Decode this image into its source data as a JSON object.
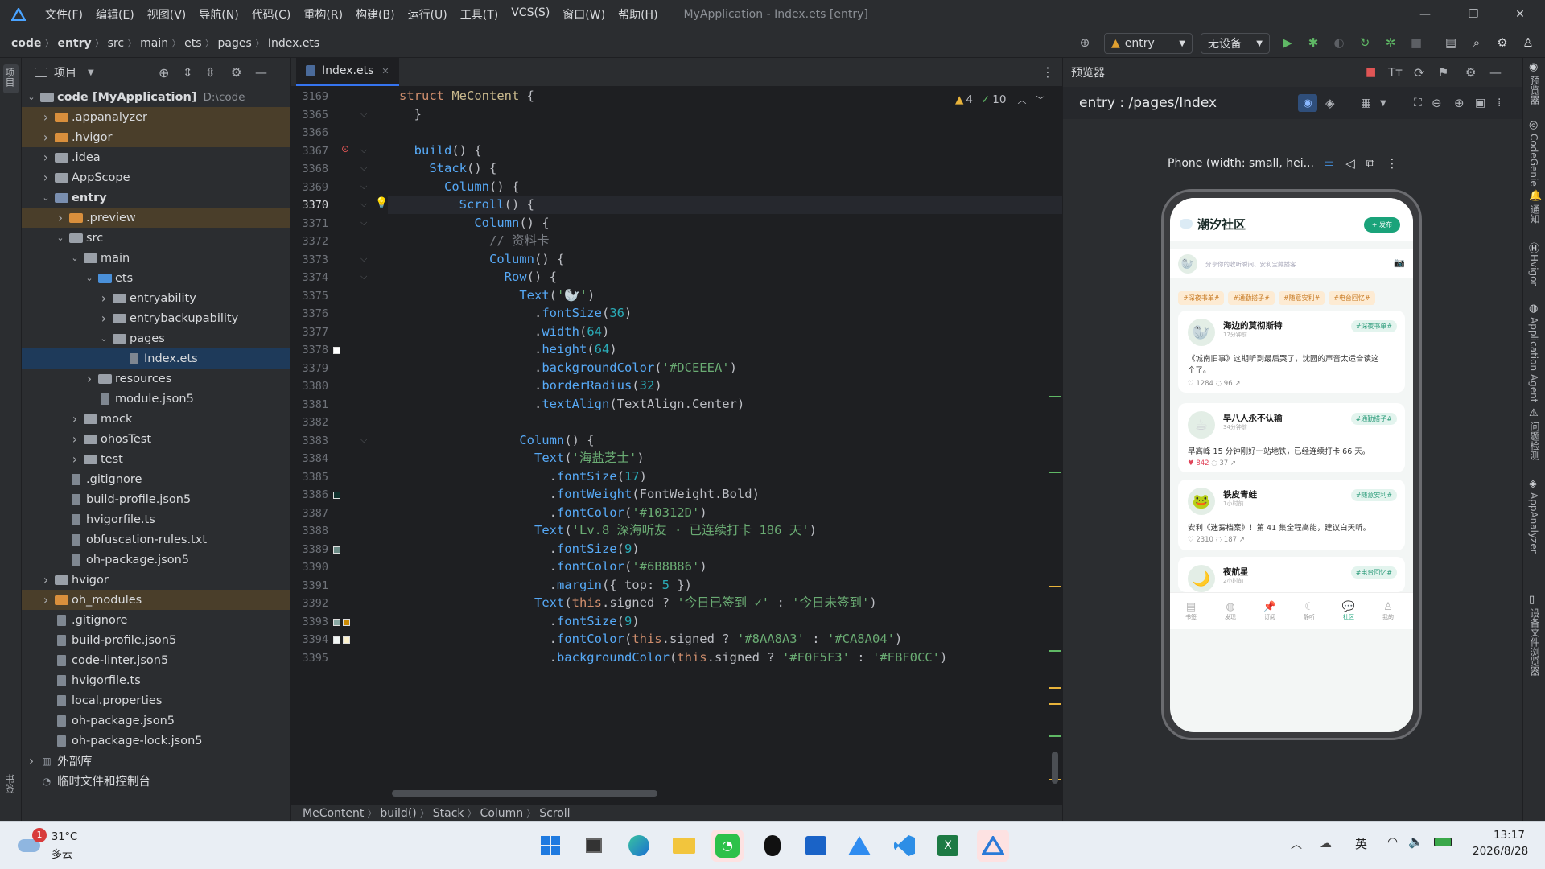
{
  "titlebar": {
    "menus": [
      "文件(F)",
      "编辑(E)",
      "视图(V)",
      "导航(N)",
      "代码(C)",
      "重构(R)",
      "构建(B)",
      "运行(U)",
      "工具(T)",
      "VCS(S)",
      "窗口(W)",
      "帮助(H)"
    ],
    "window_title": "MyApplication - Index.ets [entry]"
  },
  "breadcrumb": [
    "code",
    "entry",
    "src",
    "main",
    "ets",
    "pages",
    "Index.ets"
  ],
  "toolbar": {
    "module": "entry",
    "device": "无设备"
  },
  "project": {
    "title": "项目",
    "tree": [
      {
        "depth": 0,
        "arrow": "v",
        "kind": "folder",
        "label": "code [MyApplication]",
        "suffix": "D:\\code",
        "bold": true
      },
      {
        "depth": 1,
        "arrow": ">",
        "kind": "orange",
        "label": ".appanalyzer",
        "hl": "excl"
      },
      {
        "depth": 1,
        "arrow": ">",
        "kind": "orange",
        "label": ".hvigor",
        "hl": "excl"
      },
      {
        "depth": 1,
        "arrow": ">",
        "kind": "folder",
        "label": ".idea"
      },
      {
        "depth": 1,
        "arrow": ">",
        "kind": "folder",
        "label": "AppScope"
      },
      {
        "depth": 1,
        "arrow": "v",
        "kind": "module",
        "label": "entry",
        "bold": true
      },
      {
        "depth": 2,
        "arrow": ">",
        "kind": "orange",
        "label": ".preview",
        "hl": "excl"
      },
      {
        "depth": 2,
        "arrow": "v",
        "kind": "folder",
        "label": "src"
      },
      {
        "depth": 3,
        "arrow": "v",
        "kind": "folder",
        "label": "main"
      },
      {
        "depth": 4,
        "arrow": "v",
        "kind": "blue",
        "label": "ets"
      },
      {
        "depth": 5,
        "arrow": ">",
        "kind": "folder",
        "label": "entryability"
      },
      {
        "depth": 5,
        "arrow": ">",
        "kind": "folder",
        "label": "entrybackupability"
      },
      {
        "depth": 5,
        "arrow": "v",
        "kind": "folder",
        "label": "pages"
      },
      {
        "depth": 6,
        "arrow": "",
        "kind": "file",
        "label": "Index.ets",
        "hl": "sel"
      },
      {
        "depth": 4,
        "arrow": ">",
        "kind": "folder",
        "label": "resources"
      },
      {
        "depth": 4,
        "arrow": "",
        "kind": "file",
        "label": "module.json5"
      },
      {
        "depth": 3,
        "arrow": ">",
        "kind": "folder",
        "label": "mock"
      },
      {
        "depth": 3,
        "arrow": ">",
        "kind": "folder",
        "label": "ohosTest"
      },
      {
        "depth": 3,
        "arrow": ">",
        "kind": "folder",
        "label": "test"
      },
      {
        "depth": 2,
        "arrow": "",
        "kind": "file",
        "label": ".gitignore"
      },
      {
        "depth": 2,
        "arrow": "",
        "kind": "file",
        "label": "build-profile.json5"
      },
      {
        "depth": 2,
        "arrow": "",
        "kind": "file",
        "label": "hvigorfile.ts"
      },
      {
        "depth": 2,
        "arrow": "",
        "kind": "file",
        "label": "obfuscation-rules.txt"
      },
      {
        "depth": 2,
        "arrow": "",
        "kind": "file",
        "label": "oh-package.json5"
      },
      {
        "depth": 1,
        "arrow": ">",
        "kind": "folder",
        "label": "hvigor"
      },
      {
        "depth": 1,
        "arrow": ">",
        "kind": "orange",
        "label": "oh_modules",
        "hl": "excl"
      },
      {
        "depth": 1,
        "arrow": "",
        "kind": "file",
        "label": ".gitignore"
      },
      {
        "depth": 1,
        "arrow": "",
        "kind": "file",
        "label": "build-profile.json5"
      },
      {
        "depth": 1,
        "arrow": "",
        "kind": "file",
        "label": "code-linter.json5"
      },
      {
        "depth": 1,
        "arrow": "",
        "kind": "file",
        "label": "hvigorfile.ts"
      },
      {
        "depth": 1,
        "arrow": "",
        "kind": "file",
        "label": "local.properties"
      },
      {
        "depth": 1,
        "arrow": "",
        "kind": "file",
        "label": "oh-package.json5"
      },
      {
        "depth": 1,
        "arrow": "",
        "kind": "file",
        "label": "oh-package-lock.json5"
      },
      {
        "depth": 0,
        "arrow": ">",
        "kind": "lib",
        "label": "外部库"
      },
      {
        "depth": 0,
        "arrow": "",
        "kind": "scratch",
        "label": "临时文件和控制台"
      }
    ]
  },
  "editor": {
    "tab": "Index.ets",
    "warnings": "4",
    "checks": "10",
    "lines": [
      {
        "n": "3169",
        "html": [
          [
            "kw",
            "struct "
          ],
          [
            "typ",
            "MeContent"
          ],
          [
            "def",
            " {"
          ]
        ]
      },
      {
        "n": "3365",
        "html": [
          [
            "def",
            "  }"
          ]
        ]
      },
      {
        "n": "3366",
        "html": []
      },
      {
        "n": "3367",
        "html": [
          [
            "def",
            "  "
          ],
          [
            "fn",
            "build"
          ],
          [
            "def",
            "() {"
          ]
        ]
      },
      {
        "n": "3368",
        "html": [
          [
            "def",
            "    "
          ],
          [
            "fn2",
            "Stack"
          ],
          [
            "def",
            "() {"
          ]
        ]
      },
      {
        "n": "3369",
        "html": [
          [
            "def",
            "      "
          ],
          [
            "fn2",
            "Column"
          ],
          [
            "def",
            "() {"
          ]
        ]
      },
      {
        "n": "3370",
        "html": [
          [
            "def",
            "        "
          ],
          [
            "fn2",
            "Scroll"
          ],
          [
            "def",
            "() {"
          ]
        ],
        "cur": true
      },
      {
        "n": "3371",
        "html": [
          [
            "def",
            "          "
          ],
          [
            "fn2",
            "Column"
          ],
          [
            "def",
            "() {"
          ]
        ]
      },
      {
        "n": "3372",
        "html": [
          [
            "cmt",
            "            // 资料卡"
          ]
        ]
      },
      {
        "n": "3373",
        "html": [
          [
            "def",
            "            "
          ],
          [
            "fn2",
            "Column"
          ],
          [
            "def",
            "() {"
          ]
        ]
      },
      {
        "n": "3374",
        "html": [
          [
            "def",
            "              "
          ],
          [
            "fn2",
            "Row"
          ],
          [
            "def",
            "() {"
          ]
        ]
      },
      {
        "n": "3375",
        "html": [
          [
            "def",
            "                "
          ],
          [
            "fn2",
            "Text"
          ],
          [
            "def",
            "("
          ],
          [
            "str",
            "'🦭'"
          ],
          [
            "def",
            ")"
          ]
        ]
      },
      {
        "n": "3376",
        "html": [
          [
            "def",
            "                  ."
          ],
          [
            "fn",
            "fontSize"
          ],
          [
            "def",
            "("
          ],
          [
            "num",
            "36"
          ],
          [
            "def",
            ")"
          ]
        ]
      },
      {
        "n": "3377",
        "html": [
          [
            "def",
            "                  ."
          ],
          [
            "fn",
            "width"
          ],
          [
            "def",
            "("
          ],
          [
            "num",
            "64"
          ],
          [
            "def",
            ")"
          ]
        ]
      },
      {
        "n": "3378",
        "html": [
          [
            "def",
            "                  ."
          ],
          [
            "fn",
            "height"
          ],
          [
            "def",
            "("
          ],
          [
            "num",
            "64"
          ],
          [
            "def",
            ")"
          ]
        ]
      },
      {
        "n": "3379",
        "html": [
          [
            "def",
            "                  ."
          ],
          [
            "fn",
            "backgroundColor"
          ],
          [
            "def",
            "("
          ],
          [
            "str",
            "'#DCEEEA'"
          ],
          [
            "def",
            ")"
          ]
        ]
      },
      {
        "n": "3380",
        "html": [
          [
            "def",
            "                  ."
          ],
          [
            "fn",
            "borderRadius"
          ],
          [
            "def",
            "("
          ],
          [
            "num",
            "32"
          ],
          [
            "def",
            ")"
          ]
        ]
      },
      {
        "n": "3381",
        "html": [
          [
            "def",
            "                  ."
          ],
          [
            "fn",
            "textAlign"
          ],
          [
            "def",
            "(TextAlign.Center)"
          ]
        ]
      },
      {
        "n": "3382",
        "html": []
      },
      {
        "n": "3383",
        "html": [
          [
            "def",
            "                "
          ],
          [
            "fn2",
            "Column"
          ],
          [
            "def",
            "() {"
          ]
        ]
      },
      {
        "n": "3384",
        "html": [
          [
            "def",
            "                  "
          ],
          [
            "fn2",
            "Text"
          ],
          [
            "def",
            "("
          ],
          [
            "str",
            "'海盐芝士'"
          ],
          [
            "def",
            ")"
          ]
        ]
      },
      {
        "n": "3385",
        "html": [
          [
            "def",
            "                    ."
          ],
          [
            "fn",
            "fontSize"
          ],
          [
            "def",
            "("
          ],
          [
            "num",
            "17"
          ],
          [
            "def",
            ")"
          ]
        ]
      },
      {
        "n": "3386",
        "html": [
          [
            "def",
            "                    ."
          ],
          [
            "fn",
            "fontWeight"
          ],
          [
            "def",
            "(FontWeight.Bold)"
          ]
        ]
      },
      {
        "n": "3387",
        "html": [
          [
            "def",
            "                    ."
          ],
          [
            "fn",
            "fontColor"
          ],
          [
            "def",
            "("
          ],
          [
            "str",
            "'#10312D'"
          ],
          [
            "def",
            ")"
          ]
        ]
      },
      {
        "n": "3388",
        "html": [
          [
            "def",
            "                  "
          ],
          [
            "fn2",
            "Text"
          ],
          [
            "def",
            "("
          ],
          [
            "str",
            "'Lv.8 深海听友 · 已连续打卡 186 天'"
          ],
          [
            "def",
            ")"
          ]
        ]
      },
      {
        "n": "3389",
        "html": [
          [
            "def",
            "                    ."
          ],
          [
            "fn",
            "fontSize"
          ],
          [
            "def",
            "("
          ],
          [
            "num",
            "9"
          ],
          [
            "def",
            ")"
          ]
        ]
      },
      {
        "n": "3390",
        "html": [
          [
            "def",
            "                    ."
          ],
          [
            "fn",
            "fontColor"
          ],
          [
            "def",
            "("
          ],
          [
            "str",
            "'#6B8B86'"
          ],
          [
            "def",
            ")"
          ]
        ]
      },
      {
        "n": "3391",
        "html": [
          [
            "def",
            "                    ."
          ],
          [
            "fn",
            "margin"
          ],
          [
            "def",
            "({ "
          ],
          [
            "def",
            "top"
          ],
          [
            "def",
            ": "
          ],
          [
            "num",
            "5"
          ],
          [
            "def",
            " })"
          ]
        ]
      },
      {
        "n": "3392",
        "html": [
          [
            "def",
            "                  "
          ],
          [
            "fn2",
            "Text"
          ],
          [
            "def",
            "("
          ],
          [
            "kw",
            "this"
          ],
          [
            "def",
            ".signed ? "
          ],
          [
            "str",
            "'今日已签到 ✓'"
          ],
          [
            "def",
            " : "
          ],
          [
            "str",
            "'今日未签到'"
          ],
          [
            "def",
            ")"
          ]
        ]
      },
      {
        "n": "3393",
        "html": [
          [
            "def",
            "                    ."
          ],
          [
            "fn",
            "fontSize"
          ],
          [
            "def",
            "("
          ],
          [
            "num",
            "9"
          ],
          [
            "def",
            ")"
          ]
        ]
      },
      {
        "n": "3394",
        "html": [
          [
            "def",
            "                    ."
          ],
          [
            "fn",
            "fontColor"
          ],
          [
            "def",
            "("
          ],
          [
            "kw",
            "this"
          ],
          [
            "def",
            ".signed ? "
          ],
          [
            "str",
            "'#8AA8A3'"
          ],
          [
            "def",
            " : "
          ],
          [
            "str",
            "'#CA8A04'"
          ],
          [
            "def",
            ")"
          ]
        ]
      },
      {
        "n": "3395",
        "html": [
          [
            "def",
            "                    ."
          ],
          [
            "fn",
            "backgroundColor"
          ],
          [
            "def",
            "("
          ],
          [
            "kw",
            "this"
          ],
          [
            "def",
            ".signed ? "
          ],
          [
            "str",
            "'#F0F5F3'"
          ],
          [
            "def",
            " : "
          ],
          [
            "str",
            "'#FBF0CC'"
          ],
          [
            "def",
            ")"
          ]
        ]
      }
    ],
    "crumbs": [
      "MeContent",
      "build()",
      "Stack",
      "Column",
      "Scroll"
    ]
  },
  "previewer": {
    "title": "预览器",
    "route": "entry : /pages/Index",
    "device": "Phone (width: small, hei...",
    "app": {
      "title": "潮汐社区",
      "post_button": "+ 发布",
      "compose_placeholder": "分享你的收听瞬间、安利宝藏播客……",
      "chips": [
        "#深夜书单#",
        "#通勤搭子#",
        "#随意安利#",
        "#电台回忆#"
      ],
      "posts": [
        {
          "name": "海边的莫彻斯特",
          "meta": "17分钟前",
          "tag": "#深夜书单#",
          "text1": "《城南旧事》这期听到最后哭了，沈园的声音太适合读这",
          "text2": "个了。",
          "likes": "1284",
          "comments": "96",
          "liked": false,
          "emoji": "🦭"
        },
        {
          "name": "早八人永不认输",
          "meta": "34分钟前",
          "tag": "#通勤搭子#",
          "text1": "早高峰 15 分钟刚好一站地铁，已经连续打卡 66 天。",
          "text2": "",
          "likes": "842",
          "comments": "37",
          "liked": true,
          "emoji": "☕"
        },
        {
          "name": "铁皮青蛙",
          "meta": "1小时前",
          "tag": "#随意安利#",
          "text1": "安利《迷雾档案》！第 41 集全程高能，建议白天听。",
          "text2": "",
          "likes": "2310",
          "comments": "187",
          "liked": false,
          "emoji": "🐸"
        },
        {
          "name": "夜航星",
          "meta": "2小时前",
          "tag": "#电台回忆#",
          "text1": "",
          "text2": "",
          "likes": "",
          "comments": "",
          "liked": false,
          "emoji": "🌙"
        }
      ],
      "nav": [
        "书签",
        "发现",
        "订阅",
        "静听",
        "社区",
        "我的"
      ],
      "active_nav": 4
    }
  },
  "right_tools": [
    "预览器",
    "CodeGenie",
    "通知",
    "Hvigor",
    "Application Agent",
    "问题检测",
    "AppAnalyzer",
    "设备文件浏览器"
  ],
  "left_tools": [
    "项目",
    "书签",
    "结构"
  ],
  "taskbar": {
    "temp": "31°C",
    "weather": "多云",
    "badge": "1",
    "ime": "英",
    "time": "13:17",
    "date": "2026/8/28"
  },
  "colors": {
    "accent": "#3574f0",
    "app_primary": "#1aa37a"
  }
}
